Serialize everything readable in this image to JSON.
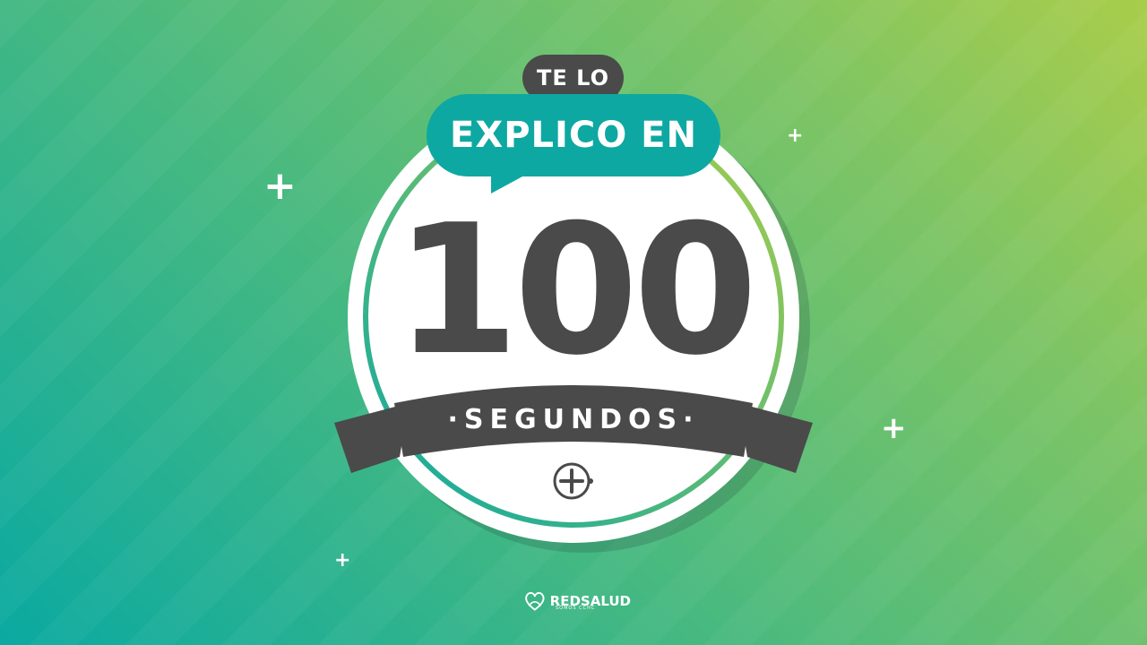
{
  "colors": {
    "teal": "#0ea8a2",
    "lime": "#a9cd4a",
    "dark": "#4a4a4a",
    "white": "#ffffff"
  },
  "bubble_small": {
    "text": "TE LO"
  },
  "bubble_large": {
    "text": "EXPLICO EN"
  },
  "counter": {
    "value": "100"
  },
  "ribbon": {
    "text": "·SEGUNDOS·"
  },
  "emblem": {
    "icon": "plus-circle-icon"
  },
  "logo": {
    "name": "REDSALUD",
    "tagline": "SOMOS CCHC",
    "icon": "heart-logo-icon"
  },
  "sparkles": [
    "+",
    "+",
    "+",
    "+"
  ]
}
